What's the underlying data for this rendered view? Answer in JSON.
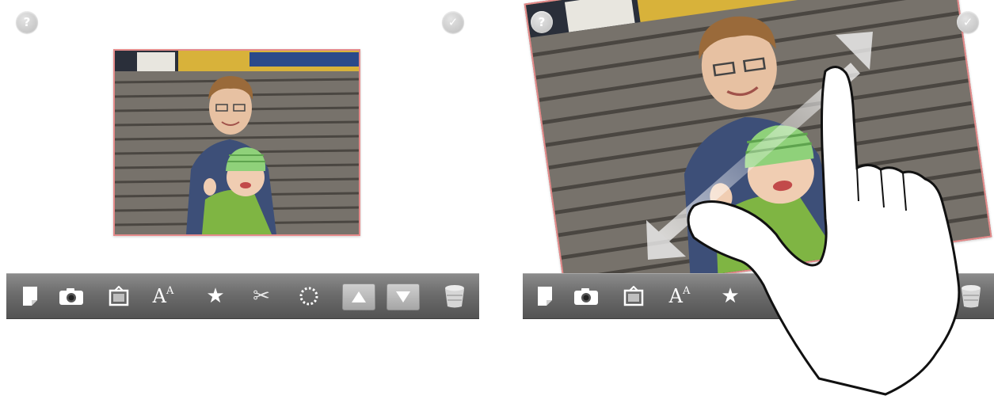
{
  "screens": [
    {
      "id": "before",
      "help_glyph": "?",
      "done_glyph": "✓",
      "photo": {
        "rotation_deg": 0,
        "border_color": "#e58a8a",
        "subject": "photo-of-two-children"
      },
      "toolbar": {
        "tools": [
          {
            "name": "new-page-icon"
          },
          {
            "name": "camera-icon"
          },
          {
            "name": "frame-icon"
          },
          {
            "name": "text-style-icon",
            "label": "A",
            "label_small": "A"
          },
          {
            "name": "star-icon",
            "label": "★"
          },
          {
            "name": "scissors-icon",
            "label": "✂"
          },
          {
            "name": "spinner-icon"
          },
          {
            "name": "bring-forward-icon"
          },
          {
            "name": "send-backward-icon"
          },
          {
            "name": "trash-icon"
          }
        ]
      }
    },
    {
      "id": "after",
      "help_glyph": "?",
      "done_glyph": "✓",
      "photo": {
        "rotation_deg": -8,
        "scale": "enlarged",
        "border_color": "#e58a8a"
      },
      "gesture": {
        "type": "pinch-spread",
        "icon": "hand-pinch-icon",
        "arrows": [
          "up-right",
          "down-left"
        ]
      }
    }
  ],
  "colors": {
    "toolbar_top": "#8b8b8b",
    "toolbar_bottom": "#535353",
    "photo_border": "#e58a8a",
    "icon": "#ffffff"
  }
}
